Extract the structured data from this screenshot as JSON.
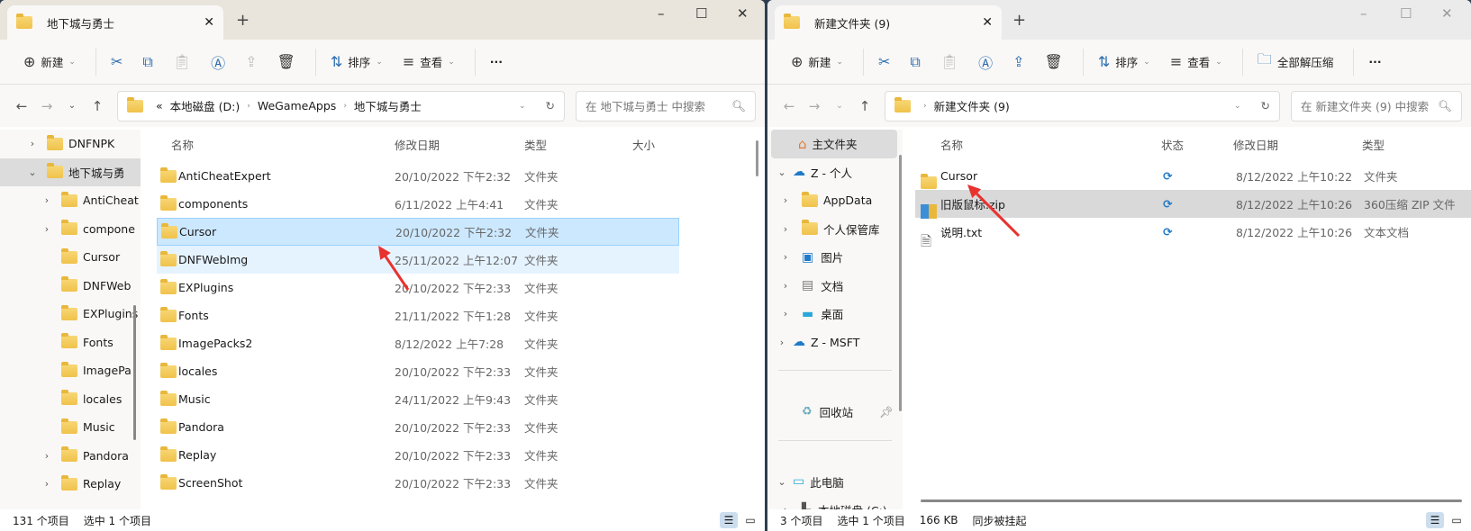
{
  "left": {
    "tab_title": "地下城与勇士",
    "toolbar": {
      "new": "新建",
      "sort": "排序",
      "view": "查看",
      "more": "···"
    },
    "path": {
      "overflow": "«",
      "segments": [
        "本地磁盘 (D:)",
        "WeGameApps",
        "地下城与勇士"
      ]
    },
    "search_placeholder": "在 地下城与勇士 中搜索",
    "sidebar": [
      {
        "label": "DNFNPK",
        "expand": "›",
        "indent": 1
      },
      {
        "label": "地下城与勇",
        "expand": "⌄",
        "indent": 1,
        "selected": true
      },
      {
        "label": "AntiCheat",
        "expand": "›",
        "indent": 2
      },
      {
        "label": "compone",
        "expand": "›",
        "indent": 2
      },
      {
        "label": "Cursor",
        "expand": "",
        "indent": 2
      },
      {
        "label": "DNFWeb",
        "expand": "",
        "indent": 2
      },
      {
        "label": "EXPlugins",
        "expand": "",
        "indent": 2
      },
      {
        "label": "Fonts",
        "expand": "",
        "indent": 2
      },
      {
        "label": "ImagePa",
        "expand": "",
        "indent": 2
      },
      {
        "label": "locales",
        "expand": "",
        "indent": 2
      },
      {
        "label": "Music",
        "expand": "",
        "indent": 2
      },
      {
        "label": "Pandora",
        "expand": "›",
        "indent": 2
      },
      {
        "label": "Replay",
        "expand": "›",
        "indent": 2
      }
    ],
    "columns": [
      "名称",
      "修改日期",
      "类型",
      "大小"
    ],
    "files": [
      {
        "name": "AntiCheatExpert",
        "date": "20/10/2022 下午2:32",
        "type": "文件夹"
      },
      {
        "name": "components",
        "date": "6/11/2022 上午4:41",
        "type": "文件夹"
      },
      {
        "name": "Cursor",
        "date": "20/10/2022 下午2:32",
        "type": "文件夹",
        "state": "selected"
      },
      {
        "name": "DNFWebImg",
        "date": "25/11/2022 上午12:07",
        "type": "文件夹",
        "state": "hover"
      },
      {
        "name": "EXPlugins",
        "date": "20/10/2022 下午2:33",
        "type": "文件夹"
      },
      {
        "name": "Fonts",
        "date": "21/11/2022 下午1:28",
        "type": "文件夹"
      },
      {
        "name": "ImagePacks2",
        "date": "8/12/2022 上午7:28",
        "type": "文件夹"
      },
      {
        "name": "locales",
        "date": "20/10/2022 下午2:33",
        "type": "文件夹"
      },
      {
        "name": "Music",
        "date": "24/11/2022 上午9:43",
        "type": "文件夹"
      },
      {
        "name": "Pandora",
        "date": "20/10/2022 下午2:33",
        "type": "文件夹"
      },
      {
        "name": "Replay",
        "date": "20/10/2022 下午2:33",
        "type": "文件夹"
      },
      {
        "name": "ScreenShot",
        "date": "20/10/2022 下午2:33",
        "type": "文件夹"
      }
    ],
    "status": {
      "count": "131 个项目",
      "selected": "选中 1 个项目"
    }
  },
  "right": {
    "tab_title": "新建文件夹 (9)",
    "toolbar": {
      "new": "新建",
      "sort": "排序",
      "view": "查看",
      "extract": "全部解压缩",
      "more": "···"
    },
    "path": {
      "segments": [
        "新建文件夹 (9)"
      ]
    },
    "search_placeholder": "在 新建文件夹 (9) 中搜索",
    "sidebar": [
      {
        "label": "主文件夹",
        "expand": "",
        "indent": 1,
        "icon": "home",
        "selected": true
      },
      {
        "label": "Z - 个人",
        "expand": "⌄",
        "indent": 0,
        "icon": "cloud"
      },
      {
        "label": "AppData",
        "expand": "›",
        "indent": 1,
        "icon": "folder"
      },
      {
        "label": "个人保管库",
        "expand": "›",
        "indent": 1,
        "icon": "vault"
      },
      {
        "label": "图片",
        "expand": "›",
        "indent": 1,
        "icon": "pictures"
      },
      {
        "label": "文档",
        "expand": "›",
        "indent": 1,
        "icon": "documents"
      },
      {
        "label": "桌面",
        "expand": "›",
        "indent": 1,
        "icon": "desktop"
      },
      {
        "label": "Z - MSFT",
        "expand": "›",
        "indent": 0,
        "icon": "cloud"
      },
      {
        "label": "",
        "divider": true
      },
      {
        "label": "回收站",
        "expand": "",
        "indent": 1,
        "icon": "recycle",
        "pinned": true
      },
      {
        "label": "",
        "divider": true
      },
      {
        "label": "此电脑",
        "expand": "⌄",
        "indent": 0,
        "icon": "pc"
      },
      {
        "label": "本地磁盘 (C:)",
        "expand": "›",
        "indent": 1,
        "icon": "drive"
      }
    ],
    "columns": [
      "名称",
      "状态",
      "修改日期",
      "类型"
    ],
    "files": [
      {
        "name": "Cursor",
        "status": "sync",
        "date": "8/12/2022 上午10:22",
        "type": "文件夹",
        "icon": "folder"
      },
      {
        "name": "旧版鼠标.zip",
        "status": "sync",
        "date": "8/12/2022 上午10:26",
        "type": "360压缩 ZIP 文件",
        "icon": "zip",
        "state": "selected"
      },
      {
        "name": "说明.txt",
        "status": "sync",
        "date": "8/12/2022 上午10:26",
        "type": "文本文档",
        "icon": "text"
      }
    ],
    "status": {
      "count": "3 个项目",
      "selected": "选中 1 个项目",
      "size": "166 KB",
      "sync": "同步被挂起"
    }
  },
  "colors": {
    "selected_row": "#cce8ff",
    "selected_border": "#99d1ff",
    "hover_row": "#e5f3ff",
    "gray_select": "#d9d9d9",
    "annotation_arrow": "#e8322e",
    "sync_icon": "#1f7ac9"
  }
}
